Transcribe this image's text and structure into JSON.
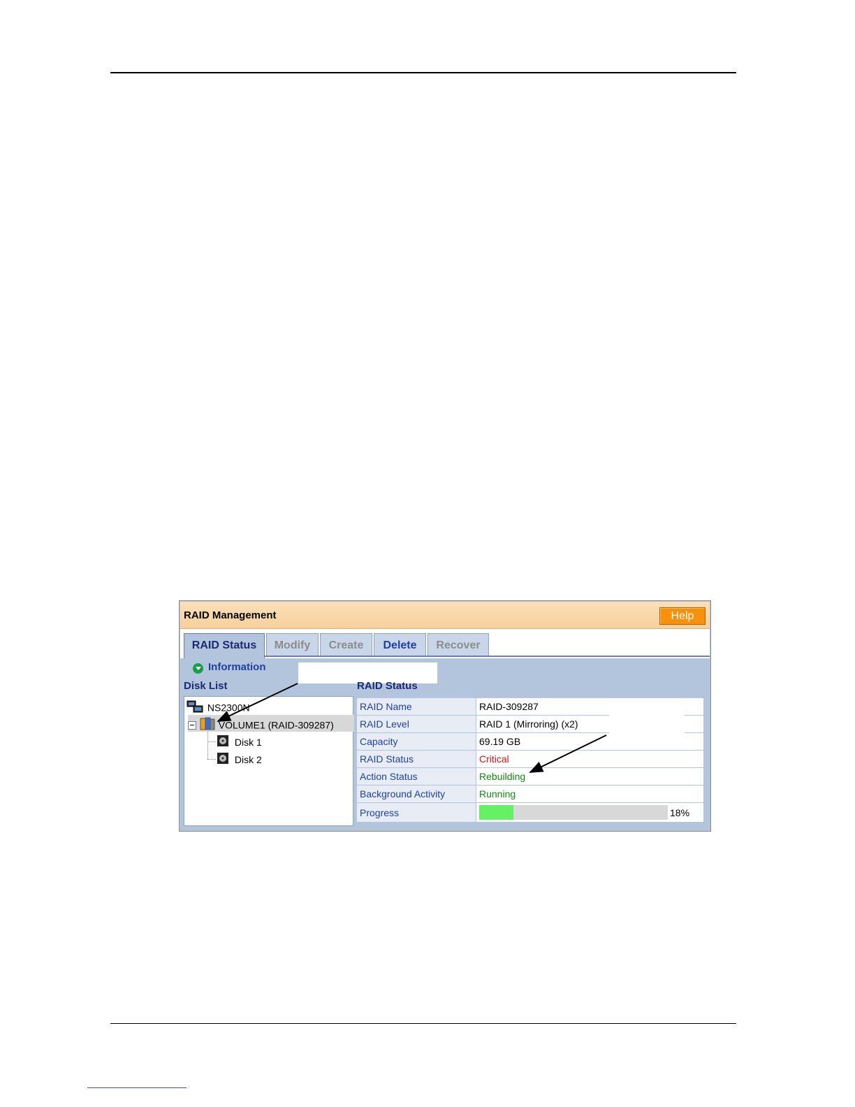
{
  "window": {
    "title": "RAID Management",
    "help_label": "Help"
  },
  "tabs": [
    {
      "label": "RAID Status",
      "state": "active"
    },
    {
      "label": "Modify",
      "state": "disabled"
    },
    {
      "label": "Create",
      "state": "disabled"
    },
    {
      "label": "Delete",
      "state": "enabled"
    },
    {
      "label": "Recover",
      "state": "disabled"
    }
  ],
  "info": {
    "label": "Information",
    "icon": "chevron-down-circle-icon"
  },
  "disk_list": {
    "header": "Disk List",
    "nodes": [
      {
        "label": "NS2300N",
        "icon": "server-icon"
      },
      {
        "label": "VOLUME1 (RAID-309287)",
        "icon": "raid-volume-icon",
        "selected": true
      },
      {
        "label": "Disk 1",
        "icon": "disk-icon"
      },
      {
        "label": "Disk 2",
        "icon": "disk-icon"
      }
    ]
  },
  "raid_status": {
    "header": "RAID Status",
    "rows": [
      {
        "label": "RAID Name",
        "value": "RAID-309287",
        "color": "#000000"
      },
      {
        "label": "RAID Level",
        "value": "RAID 1 (Mirroring) (x2)",
        "color": "#000000"
      },
      {
        "label": "Capacity",
        "value": "69.19 GB",
        "color": "#000000"
      },
      {
        "label": "RAID Status",
        "value": "Critical",
        "color": "#e01010"
      },
      {
        "label": "Action Status",
        "value": "Rebuilding",
        "color": "#118a11"
      },
      {
        "label": "Background Activity",
        "value": "Running",
        "color": "#118a11"
      }
    ],
    "progress": {
      "label": "Progress",
      "percent": 18,
      "percent_text": "18%"
    }
  },
  "colors": {
    "accent": "#f7900a",
    "panel": "#b3c4dd",
    "progress_fill": "#66f066"
  }
}
